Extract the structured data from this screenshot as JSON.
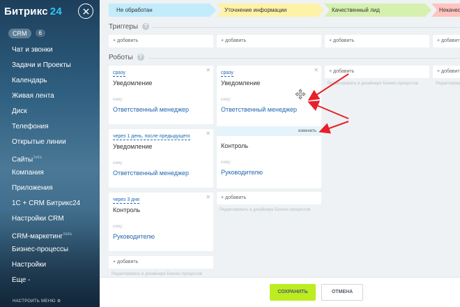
{
  "sidebar": {
    "logo": "Битрикс",
    "logo_num": "24",
    "crm_label": "CRM",
    "crm_count": "6",
    "items": [
      {
        "label": "Чат и звонки"
      },
      {
        "label": "Задачи и Проекты"
      },
      {
        "label": "Календарь"
      },
      {
        "label": "Живая лента"
      },
      {
        "label": "Диск"
      },
      {
        "label": "Телефония"
      },
      {
        "label": "Открытые линии"
      },
      {
        "label": "Сайты",
        "beta": "beta"
      },
      {
        "label": "Компания"
      },
      {
        "label": "Приложения"
      },
      {
        "label": "1С + CRM Битрикс24"
      },
      {
        "label": "Настройки CRM"
      },
      {
        "label": "CRM-маркетинг",
        "beta": "beta"
      },
      {
        "label": "Бизнес-процессы"
      },
      {
        "label": "Настройки"
      },
      {
        "label": "Еще -"
      }
    ],
    "settings_menu": "НАСТРОИТЬ МЕНЮ"
  },
  "stages": [
    "Не обработан",
    "Уточнение информации",
    "Качественный лид",
    "Некачест"
  ],
  "triggers": {
    "label": "Триггеры",
    "help": "?",
    "add": "+ добавить"
  },
  "robots": {
    "label": "Роботы",
    "help": "?",
    "add": "+ добавить",
    "hint": "Редактировать в дизайнере Бизнес-процессов",
    "col1": [
      {
        "delay": "сразу",
        "title": "Уведомление",
        "who_label": "кому:",
        "who": "Ответственный менеджер"
      },
      {
        "delay": "через 1 день, после предыдущего",
        "title": "Уведомление",
        "who_label": "кому:",
        "who": "Ответственный менеджер"
      },
      {
        "delay": "через 3 дня",
        "title": "Контроль",
        "who_label": "кому:",
        "who": "Руководителю"
      }
    ],
    "col2": [
      {
        "delay": "сразу",
        "title": "Уведомление",
        "who_label": "кому:",
        "who": "Ответственный менеджер",
        "edit": "изменить"
      },
      {
        "title": "Контроль",
        "who_label": "кому:",
        "who": "Руководителю"
      }
    ]
  },
  "footer": {
    "save": "СОХРАНИТЬ",
    "cancel": "ОТМЕНА"
  },
  "colors": {
    "save_bg": "#bbed21",
    "link": "#2067b0",
    "arrow": "#e8202a"
  }
}
